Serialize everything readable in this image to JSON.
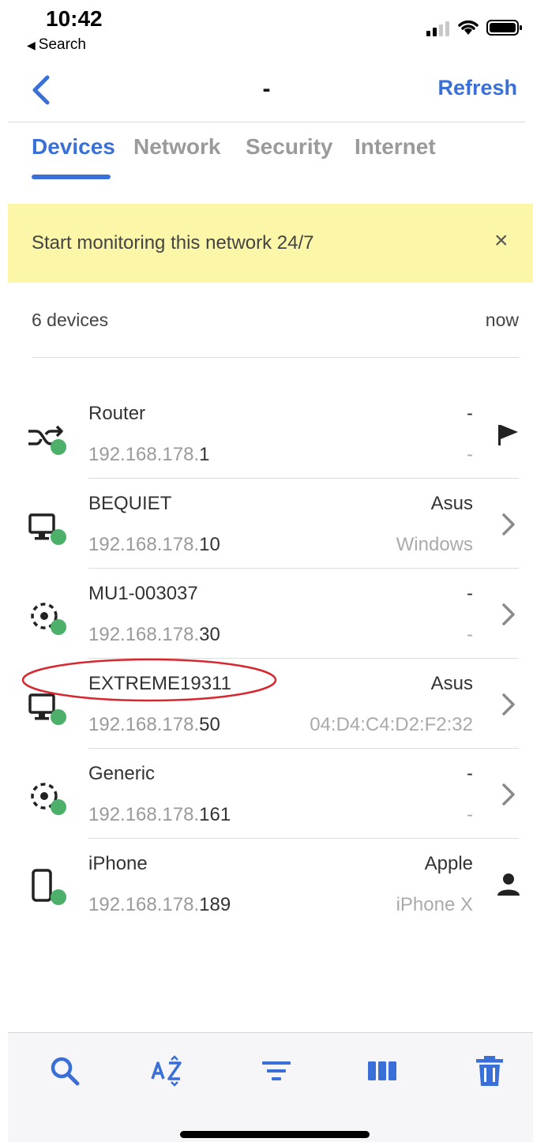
{
  "status_bar": {
    "time": "10:42",
    "back_app_label": "Search"
  },
  "navbar": {
    "title": "-",
    "refresh_label": "Refresh"
  },
  "tabs": [
    {
      "label": "Devices",
      "active": true
    },
    {
      "label": "Network",
      "active": false
    },
    {
      "label": "Security",
      "active": false
    },
    {
      "label": "Internet",
      "active": false
    }
  ],
  "banner": {
    "text": "Start monitoring this network 24/7",
    "close_glyph": "×"
  },
  "summary": {
    "count": "6 devices",
    "updated": "now"
  },
  "devices": [
    {
      "name": "Router",
      "ip_prefix": "192.168.178.",
      "ip_suffix": "1",
      "vendor": "-",
      "detail": "-",
      "icon": "router-shuffle-icon",
      "action": "flag-icon",
      "online": true
    },
    {
      "name": "BEQUIET",
      "ip_prefix": "192.168.178.",
      "ip_suffix": "10",
      "vendor": "Asus",
      "detail": "Windows",
      "icon": "desktop-icon",
      "action": "chevron-right-icon",
      "online": true
    },
    {
      "name": "MU1-003037",
      "ip_prefix": "192.168.178.",
      "ip_suffix": "30",
      "vendor": "-",
      "detail": "-",
      "icon": "generic-device-icon",
      "action": "chevron-right-icon",
      "online": true
    },
    {
      "name": "EXTREME19311",
      "ip_prefix": "192.168.178.",
      "ip_suffix": "50",
      "vendor": "Asus",
      "detail": "04:D4:C4:D2:F2:32",
      "icon": "desktop-icon",
      "action": "chevron-right-icon",
      "online": true
    },
    {
      "name": "Generic",
      "ip_prefix": "192.168.178.",
      "ip_suffix": "161",
      "vendor": "-",
      "detail": "-",
      "icon": "generic-device-icon",
      "action": "chevron-right-icon",
      "online": true
    },
    {
      "name": "iPhone",
      "ip_prefix": "192.168.178.",
      "ip_suffix": "189",
      "vendor": "Apple",
      "detail": "iPhone X",
      "icon": "phone-icon",
      "action": "person-icon",
      "online": true
    }
  ],
  "toolbar": [
    {
      "icon": "search-icon"
    },
    {
      "icon": "sort-az-icon"
    },
    {
      "icon": "filter-icon"
    },
    {
      "icon": "columns-icon"
    },
    {
      "icon": "trash-icon"
    }
  ],
  "colors": {
    "accent": "#3a6fd8",
    "banner_bg": "#fbf6a8",
    "online": "#4caf6a",
    "annotation": "#d8262e"
  }
}
